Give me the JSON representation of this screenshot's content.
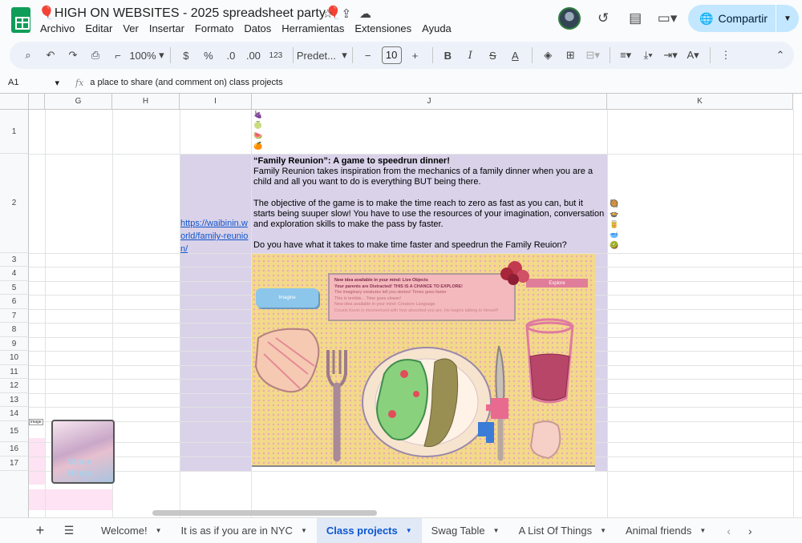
{
  "doc": {
    "title": "🎈HIGH ON WEBSITES - 2025 spreadsheet party🎈",
    "menus": [
      "Archivo",
      "Editar",
      "Ver",
      "Insertar",
      "Formato",
      "Datos",
      "Herramientas",
      "Extensiones",
      "Ayuda"
    ],
    "share_label": "Compartir"
  },
  "toolbar": {
    "zoom": "100%",
    "currency": "$",
    "percent": "%",
    "dec_less": ".0",
    "dec_more": ".00",
    "format_num": "123",
    "font": "Predet...",
    "font_size": "10"
  },
  "formula": {
    "cell_ref": "A1",
    "content": "a place to share (and comment on) class projects"
  },
  "columns": [
    "G",
    "H",
    "I",
    "J",
    "K"
  ],
  "rows": [
    "1",
    "2",
    "3",
    "4",
    "5",
    "6",
    "7",
    "8",
    "9",
    "10",
    "11",
    "12",
    "13",
    "14",
    "15",
    "16",
    "17"
  ],
  "cells": {
    "row1_emojis": "🍇\n🍈\n🍉\n🍊",
    "i2_link": "https://waibinin.world/family-reunion/",
    "j2_title": "“Family Reunion”: A game to speedrun dinner!",
    "j2_p1": "Family Reunion takes inspiration from the mechanics of a family dinner when you are a child and all you want to do is everything BUT being there.",
    "j2_p2": "The objective of the game is to make the time reach to zero as fast as you can, but it starts being suuper slow! You have to use the resources of your imagination, conversation and exploration skills to make the pass by faster.",
    "j2_p3": "Do you have what it takes to make time faster and speedrun the Family Reuion?",
    "k2_emojis": "🥘\n🍲\n🥫\n🥣\n🥝"
  },
  "game_art": {
    "imagine_label": "Imagine",
    "explore_label": "Explore",
    "lines": [
      "New idea available in your mind: Live Objects",
      "Your parents are Distracted! THIS IS A CHANCE TO EXPLORE!",
      "The imaginary creatures tell you stories! Times goes faster",
      "This is terrible... Time goes slower!",
      "New idea available in your mind: Creature Language",
      "Cousin Kevin is mesmerized with how absorbed you are. He begins talking to himself!"
    ]
  },
  "float_image": {
    "label": "image",
    "text": "Stone Hinge"
  },
  "sheets": [
    {
      "name": "Welcome!",
      "active": false
    },
    {
      "name": "It is as if you are in NYC",
      "active": false
    },
    {
      "name": "Class projects",
      "active": true
    },
    {
      "name": "Swag Table",
      "active": false
    },
    {
      "name": "A List Of Things",
      "active": false
    },
    {
      "name": "Animal friends",
      "active": false
    }
  ],
  "colors": {
    "purple_cell": "#d9d2e9",
    "share_bg": "#c2e7ff",
    "active_tab": "#0b57d0"
  }
}
